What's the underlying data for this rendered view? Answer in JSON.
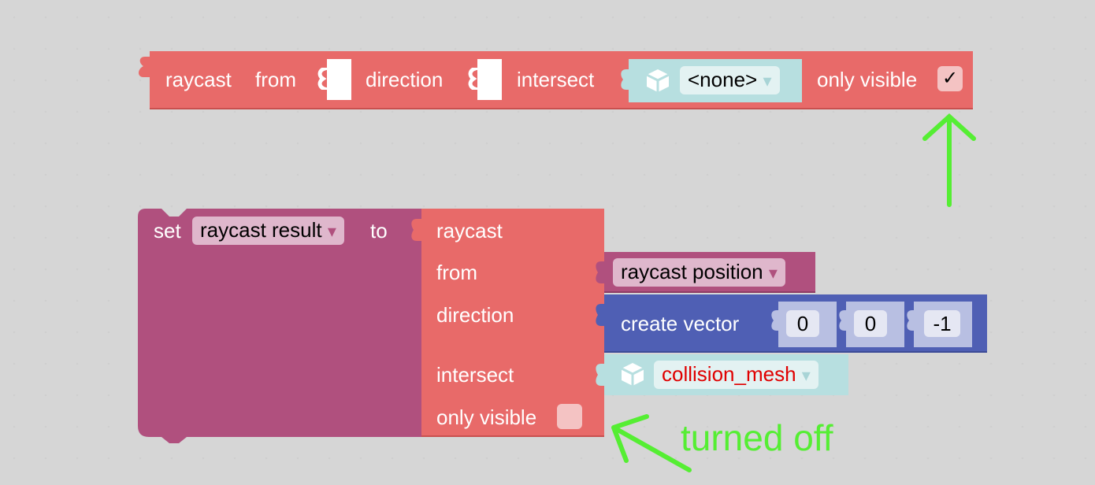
{
  "canvas": {
    "background": "#ffffff",
    "grid_dots": true
  },
  "top_block": {
    "label_raycast": "raycast",
    "label_from": "from",
    "label_direction": "direction",
    "label_intersect": "intersect",
    "mesh_dropdown_value": "<none>",
    "mesh_icon": "cube-icon",
    "label_only_visible": "only visible",
    "only_visible_checked": true,
    "check_glyph": "✓",
    "color": "#e86a69"
  },
  "bottom_block": {
    "set_label": "set",
    "variable_dropdown_value": "raycast result",
    "to_label": "to",
    "set_color": "#b0507e",
    "raycast": {
      "label_raycast": "raycast",
      "label_from": "from",
      "label_direction": "direction",
      "label_intersect": "intersect",
      "label_only_visible": "only visible",
      "only_visible_checked": false
    },
    "from_input": {
      "variable_dropdown_value": "raycast position"
    },
    "direction_input": {
      "label": "create vector",
      "x": "0",
      "y": "0",
      "z": "-1",
      "color": "#4f5fb4"
    },
    "intersect_input": {
      "mesh_dropdown_value": "collision_mesh",
      "mesh_icon": "cube-icon",
      "value_color": "#e00000"
    }
  },
  "annotations": {
    "arrow_color": "#55ee33",
    "turned_off_label": "turned off"
  },
  "dropdown_arrow": "▾"
}
